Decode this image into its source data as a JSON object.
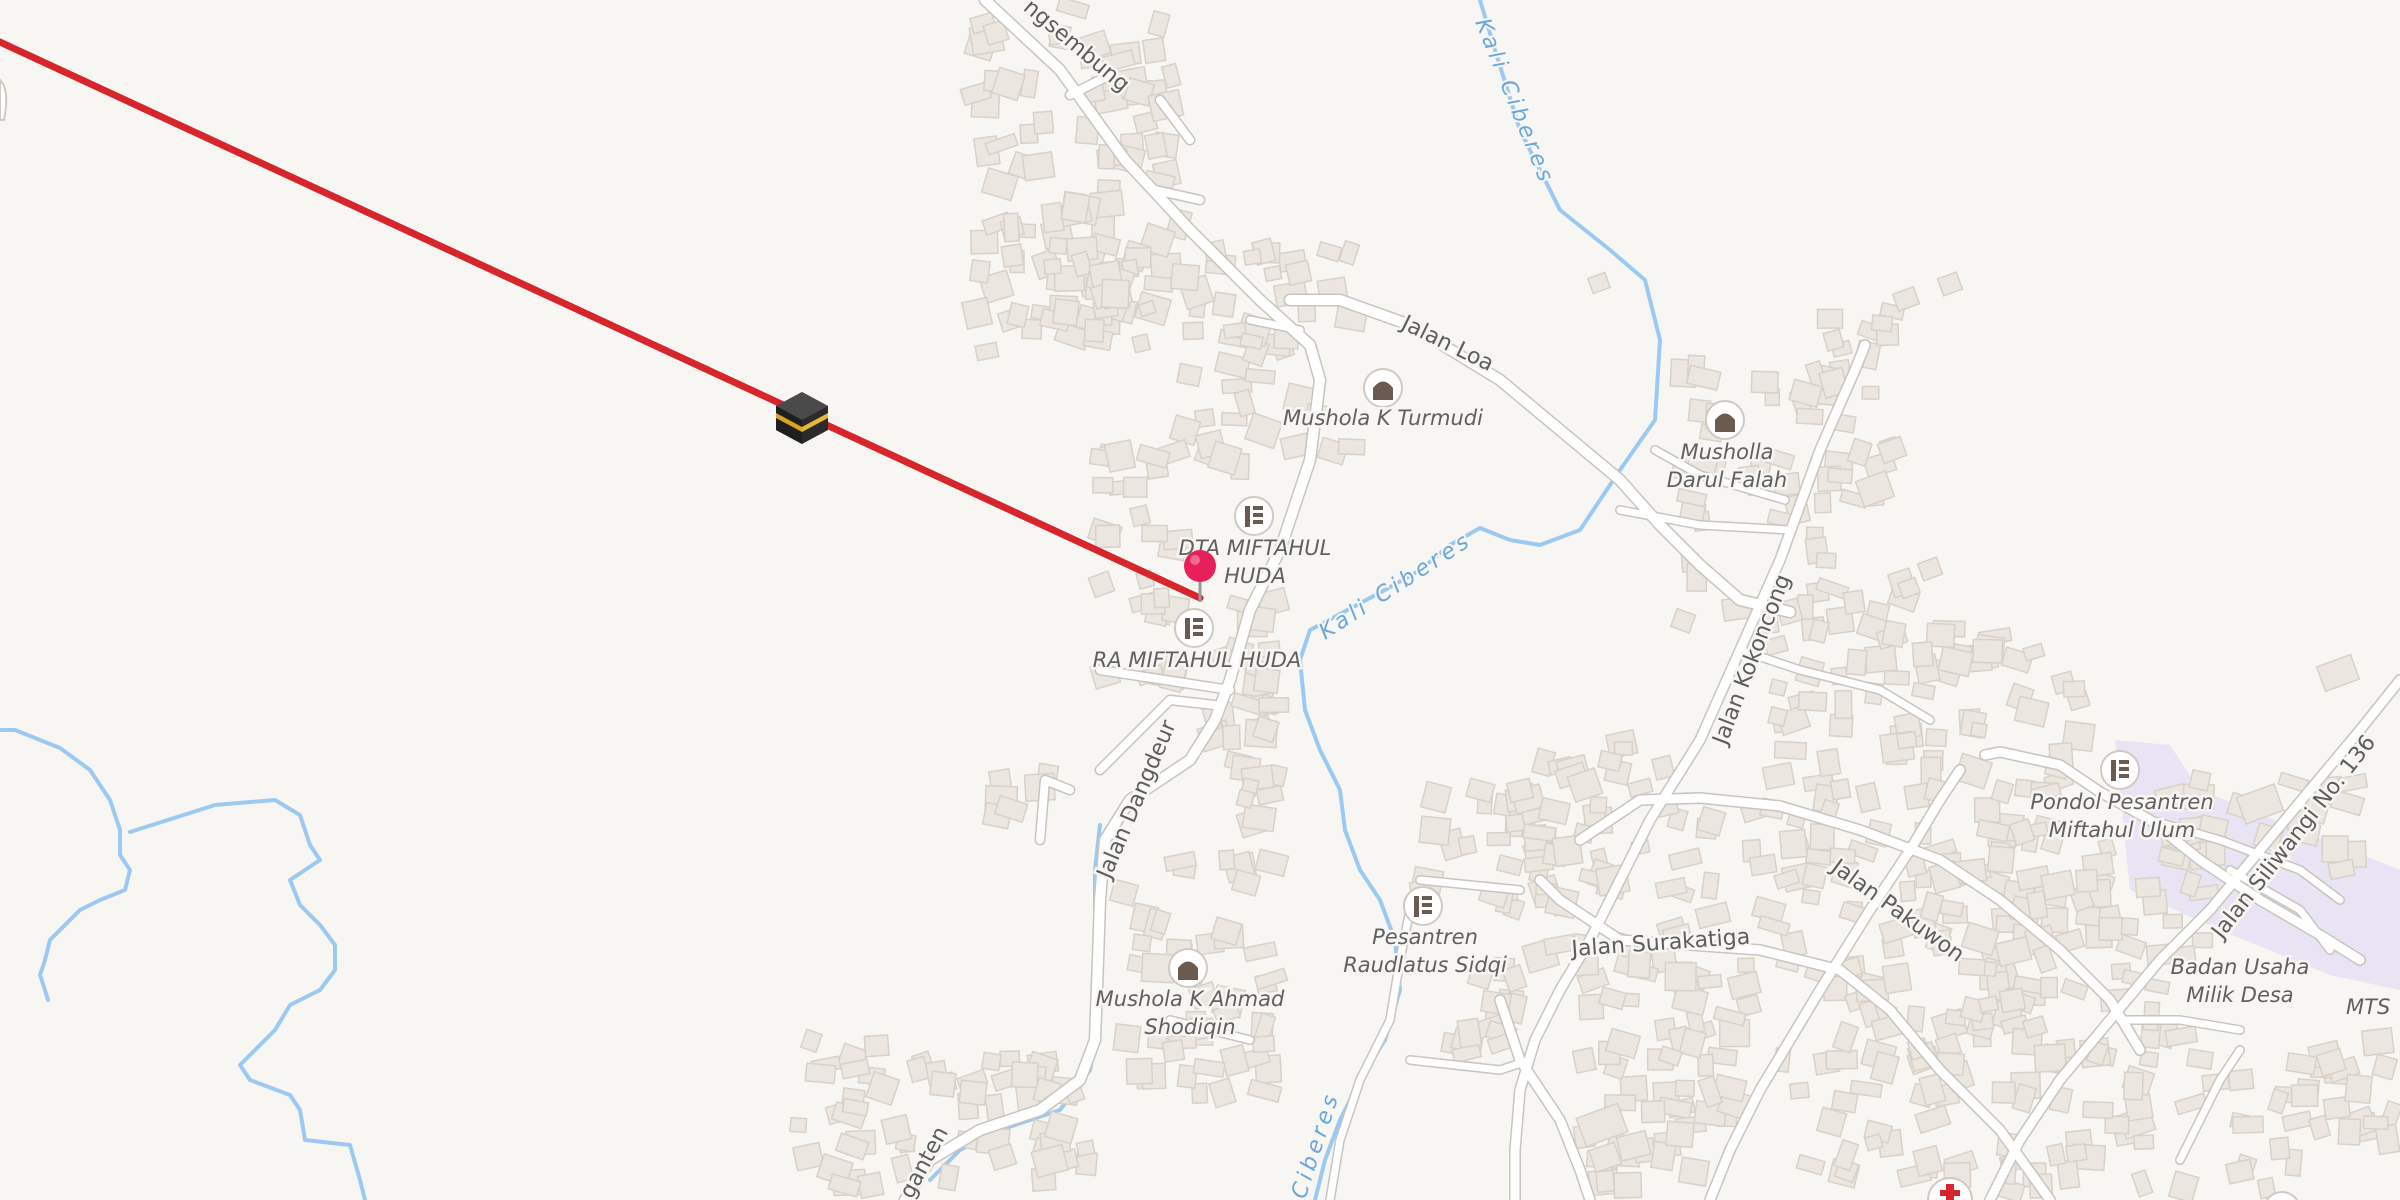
{
  "map": {
    "background_color": "#f8f6f3",
    "qibla_line_color": "#d6262c",
    "water_color": "#9cc9f2",
    "pin_color": "#e8205a"
  },
  "streets": {
    "jalan_ngasembung": "ngsembung",
    "jalan_loa": "Jalan Loa",
    "jalan_kokoncong": "Jalan Kokoncong",
    "jalan_dangdeur": "Jalan Dangdeur",
    "jalan_surakatiga": "Jalan Surakatiga",
    "jalan_pakuwon": "Jalan Pakuwon",
    "jalan_siliwangi": "Jalan Siliwangi No. 136",
    "jalan_bottom": "ganten"
  },
  "water": {
    "river_top": "Kali Ciberes",
    "river_mid": "Kali Ciberes",
    "river_bottom": "Ciberes"
  },
  "pois": {
    "mushola_turmudi": "Mushola K Turmudi",
    "musholla_darul_falah_1": "Musholla",
    "musholla_darul_falah_2": "Darul Falah",
    "dta_miftahul_huda_1": "DTA MIFTAHUL",
    "dta_miftahul_huda_2": "HUDA",
    "ra_miftahul_huda": "RA MIFTAHUL HUDA",
    "pondok_pesantren_1": "Pondol Pesantren",
    "pondok_pesantren_2": "Miftahul Ulum",
    "pesantren_raudlatus_1": "Pesantren",
    "pesantren_raudlatus_2": "Raudlatus Sidqi",
    "mushola_ahmad_1": "Mushola K Ahmad",
    "mushola_ahmad_2": "Shodiqin",
    "badan_usaha_1": "Badan Usaha",
    "badan_usaha_2": "Milik Desa",
    "mts": "MTS"
  },
  "markers": {
    "kaaba_icon": "kaaba-icon",
    "location_pin": "location-pin-icon",
    "mosque_icon": "mosque-icon",
    "school_icon": "school-icon",
    "hospital_icon": "hospital-icon"
  }
}
